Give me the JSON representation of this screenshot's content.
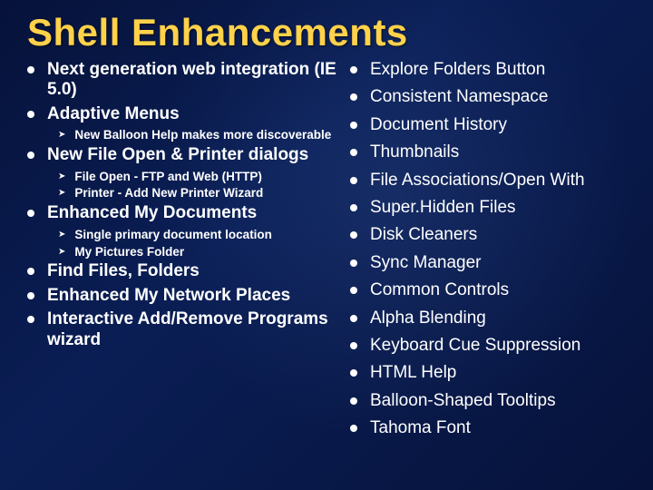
{
  "title": "Shell Enhancements",
  "left_items": [
    {
      "level": 1,
      "text": "Next generation web integration (IE 5.0)"
    },
    {
      "level": 1,
      "text": "Adaptive Menus"
    },
    {
      "level": 2,
      "text": "New Balloon Help makes more discoverable"
    },
    {
      "level": 1,
      "text": "New File Open & Printer dialogs"
    },
    {
      "level": 2,
      "text": "File Open - FTP and Web (HTTP)"
    },
    {
      "level": 2,
      "text": "Printer - Add New Printer Wizard"
    },
    {
      "level": 1,
      "text": "Enhanced My Documents"
    },
    {
      "level": 2,
      "text": "Single primary document location"
    },
    {
      "level": 2,
      "text": "My Pictures Folder"
    },
    {
      "level": 1,
      "text": "Find Files, Folders"
    },
    {
      "level": 1,
      "text": "Enhanced My Network Places"
    },
    {
      "level": 1,
      "text": "Interactive Add/Remove Programs wizard"
    }
  ],
  "right_items": [
    {
      "level": 1,
      "text": "Explore Folders Button"
    },
    {
      "level": 1,
      "text": "Consistent Namespace"
    },
    {
      "level": 1,
      "text": "Document History"
    },
    {
      "level": 1,
      "text": "Thumbnails"
    },
    {
      "level": 1,
      "text": "File Associations/Open With"
    },
    {
      "level": 1,
      "text": "Super.Hidden Files"
    },
    {
      "level": 1,
      "text": "Disk Cleaners"
    },
    {
      "level": 1,
      "text": "Sync Manager"
    },
    {
      "level": 1,
      "text": "Common Controls"
    },
    {
      "level": 1,
      "text": "Alpha Blending"
    },
    {
      "level": 1,
      "text": "Keyboard Cue Suppression"
    },
    {
      "level": 1,
      "text": "HTML Help"
    },
    {
      "level": 1,
      "text": "Balloon-Shaped Tooltips"
    },
    {
      "level": 1,
      "text": "Tahoma Font"
    }
  ]
}
